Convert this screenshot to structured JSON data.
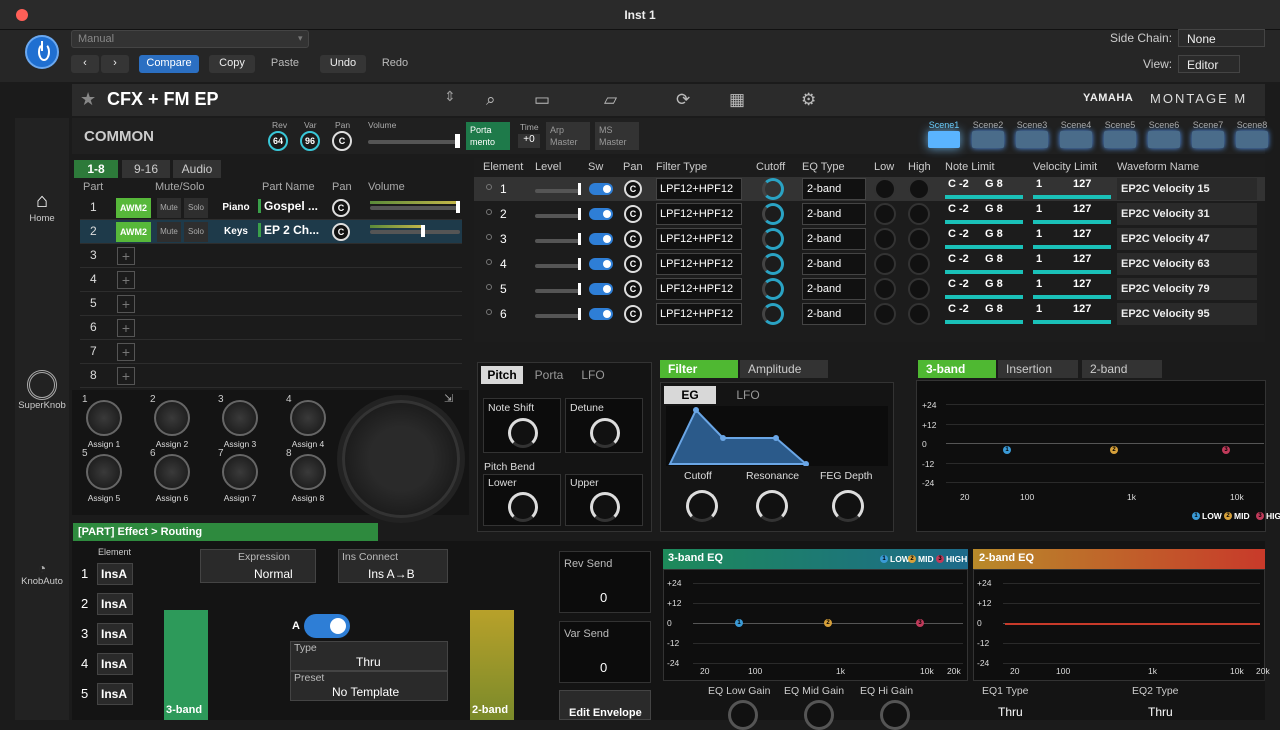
{
  "window": {
    "title": "Inst 1"
  },
  "host": {
    "preset": "Manual",
    "compare": "Compare",
    "copy": "Copy",
    "paste": "Paste",
    "undo": "Undo",
    "redo": "Redo",
    "sidechain_label": "Side Chain:",
    "sidechain_value": "None",
    "view_label": "View:",
    "view_value": "Editor"
  },
  "sidebar": {
    "home": "Home",
    "superknob": "SuperKnob",
    "knobauto": "KnobAuto"
  },
  "header": {
    "title": "CFX + FM EP",
    "brand": "YAMAHA",
    "brand2": "MONTAGE M"
  },
  "common": {
    "label": "COMMON",
    "rev_label": "Rev",
    "rev": "64",
    "var_label": "Var",
    "var": "96",
    "pan_label": "Pan",
    "pan": "C",
    "volume_label": "Volume",
    "porta": "Porta\nmento",
    "time_label": "Time",
    "time": "+0",
    "arp": "Arp\nMaster",
    "ms": "MS\nMaster"
  },
  "scenes": [
    "Scene1",
    "Scene2",
    "Scene3",
    "Scene4",
    "Scene5",
    "Scene6",
    "Scene7",
    "Scene8"
  ],
  "part_tabs": [
    "1-8",
    "9-16",
    "Audio"
  ],
  "part_headers": {
    "part": "Part",
    "mute_solo": "Mute/Solo",
    "name": "Part Name",
    "pan": "Pan",
    "volume": "Volume"
  },
  "parts": [
    {
      "num": "1",
      "engine": "AWM2",
      "mute": "Mute",
      "solo": "Solo",
      "cat": "Piano",
      "name": "Gospel ...",
      "pan": "C",
      "vol": 1.0
    },
    {
      "num": "2",
      "engine": "AWM2",
      "mute": "Mute",
      "solo": "Solo",
      "cat": "Keys",
      "name": "EP 2 Ch...",
      "pan": "C",
      "vol": 0.6
    },
    {
      "num": "3"
    },
    {
      "num": "4"
    },
    {
      "num": "5"
    },
    {
      "num": "6"
    },
    {
      "num": "7"
    },
    {
      "num": "8"
    }
  ],
  "assigns": [
    "Assign 1",
    "Assign 2",
    "Assign 3",
    "Assign 4",
    "Assign 5",
    "Assign 6",
    "Assign 7",
    "Assign 8"
  ],
  "element_headers": {
    "element": "Element",
    "level": "Level",
    "sw": "Sw",
    "pan": "Pan",
    "filter": "Filter Type",
    "cutoff": "Cutoff",
    "eq": "EQ Type",
    "low": "Low",
    "high": "High",
    "note": "Note Limit",
    "vel": "Velocity Limit",
    "wave": "Waveform Name"
  },
  "elements": [
    {
      "n": "1",
      "pan": "C",
      "filter": "LPF12+HPF12",
      "eq": "2-band",
      "nlo": "C -2",
      "nhi": "G 8",
      "vlo": "1",
      "vhi": "127",
      "wave": "EP2C Velocity 15"
    },
    {
      "n": "2",
      "pan": "C",
      "filter": "LPF12+HPF12",
      "eq": "2-band",
      "nlo": "C -2",
      "nhi": "G 8",
      "vlo": "1",
      "vhi": "127",
      "wave": "EP2C Velocity 31"
    },
    {
      "n": "3",
      "pan": "C",
      "filter": "LPF12+HPF12",
      "eq": "2-band",
      "nlo": "C -2",
      "nhi": "G 8",
      "vlo": "1",
      "vhi": "127",
      "wave": "EP2C Velocity 47"
    },
    {
      "n": "4",
      "pan": "C",
      "filter": "LPF12+HPF12",
      "eq": "2-band",
      "nlo": "C -2",
      "nhi": "G 8",
      "vlo": "1",
      "vhi": "127",
      "wave": "EP2C Velocity 63"
    },
    {
      "n": "5",
      "pan": "C",
      "filter": "LPF12+HPF12",
      "eq": "2-band",
      "nlo": "C -2",
      "nhi": "G 8",
      "vlo": "1",
      "vhi": "127",
      "wave": "EP2C Velocity 79"
    },
    {
      "n": "6",
      "pan": "C",
      "filter": "LPF12+HPF12",
      "eq": "2-band",
      "nlo": "C -2",
      "nhi": "G 8",
      "vlo": "1",
      "vhi": "127",
      "wave": "EP2C Velocity 95"
    }
  ],
  "pitch_panel": {
    "tabs": [
      "Pitch",
      "Porta",
      "LFO"
    ],
    "note_shift": "Note Shift",
    "detune": "Detune",
    "pitch_bend": "Pitch Bend",
    "lower": "Lower",
    "upper": "Upper"
  },
  "filter_panel": {
    "tabs": [
      "Filter",
      "Amplitude"
    ],
    "sub_tabs": [
      "EG",
      "LFO"
    ],
    "cutoff": "Cutoff",
    "resonance": "Resonance",
    "feg": "FEG Depth"
  },
  "eq_panel": {
    "tabs": [
      "3-band",
      "Insertion",
      "2-band"
    ],
    "y": [
      "+24",
      "+12",
      "0",
      "-12",
      "-24"
    ],
    "x": [
      "20",
      "100",
      "1k",
      "10k"
    ],
    "legend": [
      "LOW",
      "MID",
      "HIGH"
    ]
  },
  "routing": {
    "title": "[PART] Effect > Routing",
    "element_label": "Element",
    "rows": [
      "1",
      "2",
      "3",
      "4",
      "5"
    ],
    "ins": "InsA",
    "expr_label": "Expression",
    "expr_value": "Normal",
    "insconn_label": "Ins Connect",
    "insconn_value": "Ins A→B",
    "a_label": "A",
    "type_label": "Type",
    "type_value": "Thru",
    "preset_label": "Preset",
    "preset_value": "No Template",
    "band3": "3-band",
    "band2": "2-band",
    "rev_send": "Rev Send",
    "rev_send_val": "0",
    "var_send": "Var Send",
    "var_send_val": "0",
    "edit_env": "Edit Envelope"
  },
  "eq3": {
    "title": "3-band EQ",
    "legend": [
      "LOW",
      "MID",
      "HIGH"
    ],
    "y": [
      "+24",
      "+12",
      "0",
      "-12",
      "-24"
    ],
    "x": [
      "20",
      "100",
      "1k",
      "10k",
      "20k"
    ],
    "low_gain": "EQ Low Gain",
    "mid_gain": "EQ Mid Gain",
    "hi_gain": "EQ Hi Gain"
  },
  "eq2": {
    "title": "2-band EQ",
    "y": [
      "+24",
      "+12",
      "0",
      "-12",
      "-24"
    ],
    "x": [
      "20",
      "100",
      "1k",
      "10k",
      "20k"
    ],
    "type1_label": "EQ1 Type",
    "type1": "Thru",
    "type2_label": "EQ2 Type",
    "type2": "Thru"
  }
}
